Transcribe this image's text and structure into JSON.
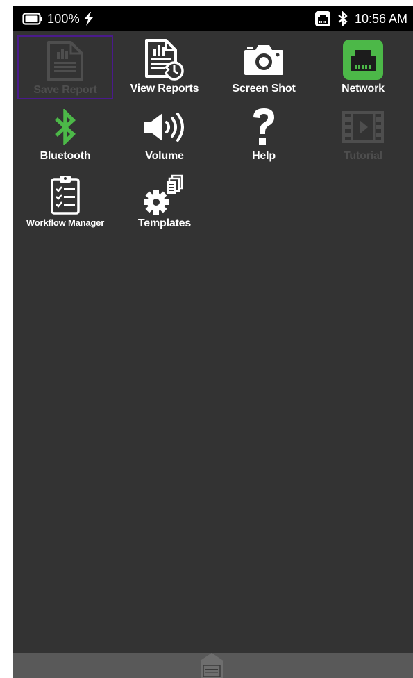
{
  "status_bar": {
    "battery": "100%",
    "time": "10:56 AM",
    "icons": [
      "battery-icon",
      "charging-bolt-icon",
      "ethernet-icon",
      "bluetooth-icon"
    ]
  },
  "tiles": [
    {
      "label": "Save Report",
      "icon": "save-report-icon",
      "state": "disabled-selected"
    },
    {
      "label": "View Reports",
      "icon": "view-reports-icon",
      "state": "enabled"
    },
    {
      "label": "Screen Shot",
      "icon": "camera-icon",
      "state": "enabled"
    },
    {
      "label": "Network",
      "icon": "network-icon",
      "state": "active"
    },
    {
      "label": "Bluetooth",
      "icon": "bluetooth-icon",
      "state": "enabled"
    },
    {
      "label": "Volume",
      "icon": "volume-icon",
      "state": "enabled"
    },
    {
      "label": "Help",
      "icon": "help-icon",
      "state": "enabled"
    },
    {
      "label": "Tutorial",
      "icon": "film-icon",
      "state": "disabled"
    },
    {
      "label": "Workflow Manager",
      "icon": "clipboard-checklist-icon",
      "state": "enabled"
    },
    {
      "label": "Templates",
      "icon": "templates-gear-icon",
      "state": "enabled"
    }
  ],
  "colors": {
    "background": "#333333",
    "status_bar": "#000000",
    "accent_green": "#4cb848",
    "disabled": "#4e4e4e",
    "selection_border": "#4a1a8c",
    "bottom_bar": "#595959"
  }
}
